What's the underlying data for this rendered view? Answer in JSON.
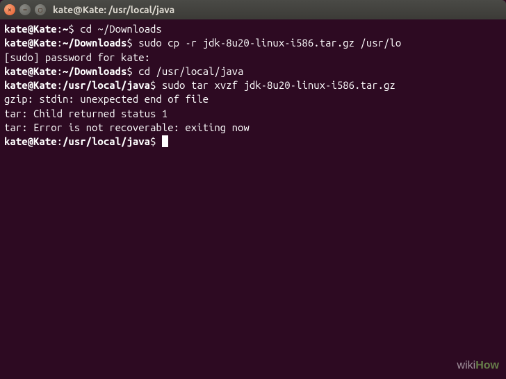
{
  "window": {
    "title": "kate@Kate: /usr/local/java"
  },
  "terminal": {
    "lines": [
      {
        "prompt_user": "kate@Kate",
        "prompt_path": "~",
        "prompt_dollar": "$",
        "command": "cd ~/Downloads"
      },
      {
        "prompt_user": "kate@Kate",
        "prompt_path": "~/Downloads",
        "prompt_dollar": "$",
        "command": "sudo cp -r jdk-8u20-linux-i586.tar.gz /usr/lo"
      },
      {
        "text": "[sudo] password for kate:"
      },
      {
        "prompt_user": "kate@Kate",
        "prompt_path": "~/Downloads",
        "prompt_dollar": "$",
        "command": "cd /usr/local/java"
      },
      {
        "prompt_user": "kate@Kate",
        "prompt_path": "/usr/local/java",
        "prompt_dollar": "$",
        "command": "sudo tar xvzf jdk-8u20-linux-i586.tar.gz"
      },
      {
        "text": ""
      },
      {
        "text": "gzip: stdin: unexpected end of file"
      },
      {
        "text": "tar: Child returned status 1"
      },
      {
        "text": "tar: Error is not recoverable: exiting now"
      },
      {
        "prompt_user": "kate@Kate",
        "prompt_path": "/usr/local/java",
        "prompt_dollar": "$",
        "command": "",
        "cursor": true
      }
    ]
  },
  "watermark": {
    "wiki": "wiki",
    "how": "How"
  }
}
